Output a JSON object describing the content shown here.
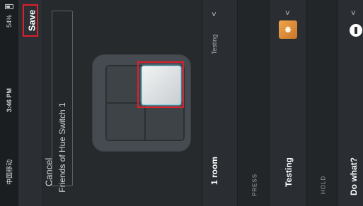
{
  "status_bar": {
    "time": "3:46 PM",
    "carrier": "中国移动",
    "battery": "54%"
  },
  "nav": {
    "save_label": "Save",
    "cancel_label": "Cancel"
  },
  "name_field": {
    "value": "Friends of Hue Switch 1"
  },
  "rooms": {
    "value": "1 room",
    "status": "Testing"
  },
  "actions": {
    "press_label": "PRESS",
    "press_scene": "Testing",
    "hold_label": "HOLD",
    "hold_value": "Do what?"
  },
  "icons": {
    "chevron": "chevron-up-icon",
    "scene": "scene-sun-icon",
    "hold": "power-icon"
  },
  "colors": {
    "highlight": "#e01e2b",
    "scene_icon": "#e39241",
    "selected_glow": "#7fd6ea"
  }
}
